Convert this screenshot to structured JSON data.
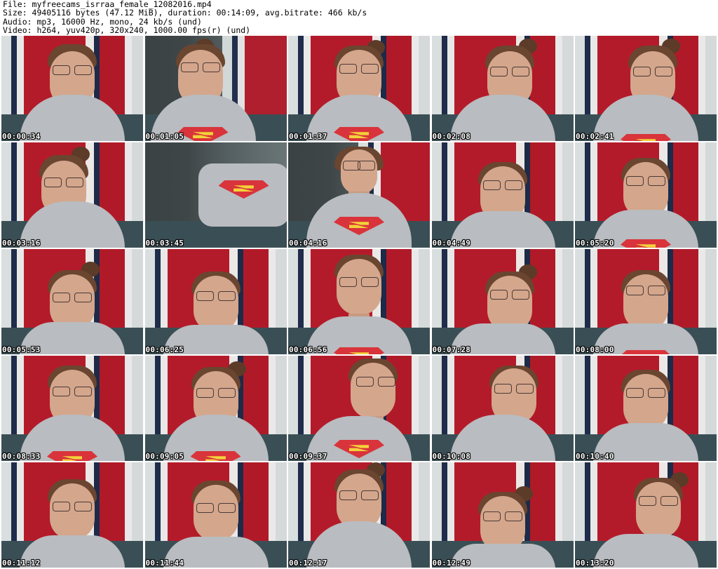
{
  "header": {
    "file_line": "File: myfreecams_isrraa_female_12082016.mp4",
    "size_line": "Size: 49405116 bytes (47.12 MiB), duration: 00:14:09, avg.bitrate: 466 kb/s",
    "audio_line": "Audio: mp3, 16000 Hz, mono, 24 kb/s (und)",
    "video_line": "Video: h264, yuv420p, 320x240, 1000.00 fps(r) (und)"
  },
  "thumbnails": [
    {
      "timestamp": "00:00:34"
    },
    {
      "timestamp": "00:01:05"
    },
    {
      "timestamp": "00:01:37"
    },
    {
      "timestamp": "00:02:08"
    },
    {
      "timestamp": "00:02:41"
    },
    {
      "timestamp": "00:03:16"
    },
    {
      "timestamp": "00:03:45"
    },
    {
      "timestamp": "00:04:16"
    },
    {
      "timestamp": "00:04:49"
    },
    {
      "timestamp": "00:05:20"
    },
    {
      "timestamp": "00:05:53"
    },
    {
      "timestamp": "00:06:25"
    },
    {
      "timestamp": "00:06:56"
    },
    {
      "timestamp": "00:07:28"
    },
    {
      "timestamp": "00:08:00"
    },
    {
      "timestamp": "00:08:33"
    },
    {
      "timestamp": "00:09:05"
    },
    {
      "timestamp": "00:09:37"
    },
    {
      "timestamp": "00:10:08"
    },
    {
      "timestamp": "00:10:40"
    },
    {
      "timestamp": "00:11:12"
    },
    {
      "timestamp": "00:11:44"
    },
    {
      "timestamp": "00:12:17"
    },
    {
      "timestamp": "00:12:49"
    },
    {
      "timestamp": "00:13:20"
    }
  ]
}
